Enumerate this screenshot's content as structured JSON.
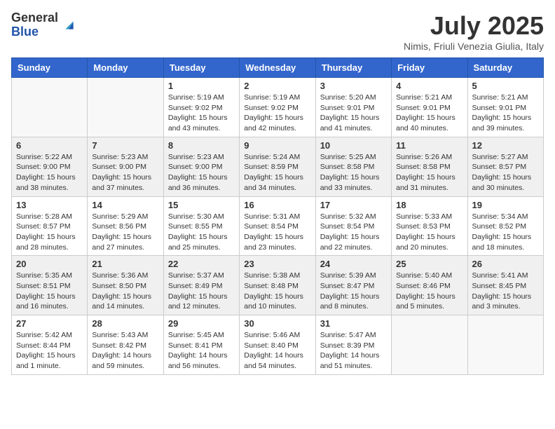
{
  "logo": {
    "general": "General",
    "blue": "Blue"
  },
  "title": "July 2025",
  "location": "Nimis, Friuli Venezia Giulia, Italy",
  "weekdays": [
    "Sunday",
    "Monday",
    "Tuesday",
    "Wednesday",
    "Thursday",
    "Friday",
    "Saturday"
  ],
  "weeks": [
    [
      {
        "day": "",
        "info": ""
      },
      {
        "day": "",
        "info": ""
      },
      {
        "day": "1",
        "info": "Sunrise: 5:19 AM\nSunset: 9:02 PM\nDaylight: 15 hours and 43 minutes."
      },
      {
        "day": "2",
        "info": "Sunrise: 5:19 AM\nSunset: 9:02 PM\nDaylight: 15 hours and 42 minutes."
      },
      {
        "day": "3",
        "info": "Sunrise: 5:20 AM\nSunset: 9:01 PM\nDaylight: 15 hours and 41 minutes."
      },
      {
        "day": "4",
        "info": "Sunrise: 5:21 AM\nSunset: 9:01 PM\nDaylight: 15 hours and 40 minutes."
      },
      {
        "day": "5",
        "info": "Sunrise: 5:21 AM\nSunset: 9:01 PM\nDaylight: 15 hours and 39 minutes."
      }
    ],
    [
      {
        "day": "6",
        "info": "Sunrise: 5:22 AM\nSunset: 9:00 PM\nDaylight: 15 hours and 38 minutes."
      },
      {
        "day": "7",
        "info": "Sunrise: 5:23 AM\nSunset: 9:00 PM\nDaylight: 15 hours and 37 minutes."
      },
      {
        "day": "8",
        "info": "Sunrise: 5:23 AM\nSunset: 9:00 PM\nDaylight: 15 hours and 36 minutes."
      },
      {
        "day": "9",
        "info": "Sunrise: 5:24 AM\nSunset: 8:59 PM\nDaylight: 15 hours and 34 minutes."
      },
      {
        "day": "10",
        "info": "Sunrise: 5:25 AM\nSunset: 8:58 PM\nDaylight: 15 hours and 33 minutes."
      },
      {
        "day": "11",
        "info": "Sunrise: 5:26 AM\nSunset: 8:58 PM\nDaylight: 15 hours and 31 minutes."
      },
      {
        "day": "12",
        "info": "Sunrise: 5:27 AM\nSunset: 8:57 PM\nDaylight: 15 hours and 30 minutes."
      }
    ],
    [
      {
        "day": "13",
        "info": "Sunrise: 5:28 AM\nSunset: 8:57 PM\nDaylight: 15 hours and 28 minutes."
      },
      {
        "day": "14",
        "info": "Sunrise: 5:29 AM\nSunset: 8:56 PM\nDaylight: 15 hours and 27 minutes."
      },
      {
        "day": "15",
        "info": "Sunrise: 5:30 AM\nSunset: 8:55 PM\nDaylight: 15 hours and 25 minutes."
      },
      {
        "day": "16",
        "info": "Sunrise: 5:31 AM\nSunset: 8:54 PM\nDaylight: 15 hours and 23 minutes."
      },
      {
        "day": "17",
        "info": "Sunrise: 5:32 AM\nSunset: 8:54 PM\nDaylight: 15 hours and 22 minutes."
      },
      {
        "day": "18",
        "info": "Sunrise: 5:33 AM\nSunset: 8:53 PM\nDaylight: 15 hours and 20 minutes."
      },
      {
        "day": "19",
        "info": "Sunrise: 5:34 AM\nSunset: 8:52 PM\nDaylight: 15 hours and 18 minutes."
      }
    ],
    [
      {
        "day": "20",
        "info": "Sunrise: 5:35 AM\nSunset: 8:51 PM\nDaylight: 15 hours and 16 minutes."
      },
      {
        "day": "21",
        "info": "Sunrise: 5:36 AM\nSunset: 8:50 PM\nDaylight: 15 hours and 14 minutes."
      },
      {
        "day": "22",
        "info": "Sunrise: 5:37 AM\nSunset: 8:49 PM\nDaylight: 15 hours and 12 minutes."
      },
      {
        "day": "23",
        "info": "Sunrise: 5:38 AM\nSunset: 8:48 PM\nDaylight: 15 hours and 10 minutes."
      },
      {
        "day": "24",
        "info": "Sunrise: 5:39 AM\nSunset: 8:47 PM\nDaylight: 15 hours and 8 minutes."
      },
      {
        "day": "25",
        "info": "Sunrise: 5:40 AM\nSunset: 8:46 PM\nDaylight: 15 hours and 5 minutes."
      },
      {
        "day": "26",
        "info": "Sunrise: 5:41 AM\nSunset: 8:45 PM\nDaylight: 15 hours and 3 minutes."
      }
    ],
    [
      {
        "day": "27",
        "info": "Sunrise: 5:42 AM\nSunset: 8:44 PM\nDaylight: 15 hours and 1 minute."
      },
      {
        "day": "28",
        "info": "Sunrise: 5:43 AM\nSunset: 8:42 PM\nDaylight: 14 hours and 59 minutes."
      },
      {
        "day": "29",
        "info": "Sunrise: 5:45 AM\nSunset: 8:41 PM\nDaylight: 14 hours and 56 minutes."
      },
      {
        "day": "30",
        "info": "Sunrise: 5:46 AM\nSunset: 8:40 PM\nDaylight: 14 hours and 54 minutes."
      },
      {
        "day": "31",
        "info": "Sunrise: 5:47 AM\nSunset: 8:39 PM\nDaylight: 14 hours and 51 minutes."
      },
      {
        "day": "",
        "info": ""
      },
      {
        "day": "",
        "info": ""
      }
    ]
  ]
}
